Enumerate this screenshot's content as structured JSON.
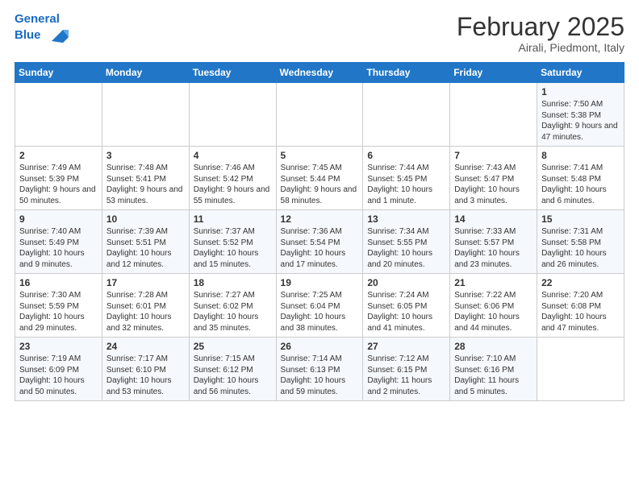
{
  "header": {
    "logo_line1": "General",
    "logo_line2": "Blue",
    "title": "February 2025",
    "subtitle": "Airali, Piedmont, Italy"
  },
  "days_of_week": [
    "Sunday",
    "Monday",
    "Tuesday",
    "Wednesday",
    "Thursday",
    "Friday",
    "Saturday"
  ],
  "weeks": [
    [
      {
        "day": "",
        "info": ""
      },
      {
        "day": "",
        "info": ""
      },
      {
        "day": "",
        "info": ""
      },
      {
        "day": "",
        "info": ""
      },
      {
        "day": "",
        "info": ""
      },
      {
        "day": "",
        "info": ""
      },
      {
        "day": "1",
        "info": "Sunrise: 7:50 AM\nSunset: 5:38 PM\nDaylight: 9 hours and 47 minutes."
      }
    ],
    [
      {
        "day": "2",
        "info": "Sunrise: 7:49 AM\nSunset: 5:39 PM\nDaylight: 9 hours and 50 minutes."
      },
      {
        "day": "3",
        "info": "Sunrise: 7:48 AM\nSunset: 5:41 PM\nDaylight: 9 hours and 53 minutes."
      },
      {
        "day": "4",
        "info": "Sunrise: 7:46 AM\nSunset: 5:42 PM\nDaylight: 9 hours and 55 minutes."
      },
      {
        "day": "5",
        "info": "Sunrise: 7:45 AM\nSunset: 5:44 PM\nDaylight: 9 hours and 58 minutes."
      },
      {
        "day": "6",
        "info": "Sunrise: 7:44 AM\nSunset: 5:45 PM\nDaylight: 10 hours and 1 minute."
      },
      {
        "day": "7",
        "info": "Sunrise: 7:43 AM\nSunset: 5:47 PM\nDaylight: 10 hours and 3 minutes."
      },
      {
        "day": "8",
        "info": "Sunrise: 7:41 AM\nSunset: 5:48 PM\nDaylight: 10 hours and 6 minutes."
      }
    ],
    [
      {
        "day": "9",
        "info": "Sunrise: 7:40 AM\nSunset: 5:49 PM\nDaylight: 10 hours and 9 minutes."
      },
      {
        "day": "10",
        "info": "Sunrise: 7:39 AM\nSunset: 5:51 PM\nDaylight: 10 hours and 12 minutes."
      },
      {
        "day": "11",
        "info": "Sunrise: 7:37 AM\nSunset: 5:52 PM\nDaylight: 10 hours and 15 minutes."
      },
      {
        "day": "12",
        "info": "Sunrise: 7:36 AM\nSunset: 5:54 PM\nDaylight: 10 hours and 17 minutes."
      },
      {
        "day": "13",
        "info": "Sunrise: 7:34 AM\nSunset: 5:55 PM\nDaylight: 10 hours and 20 minutes."
      },
      {
        "day": "14",
        "info": "Sunrise: 7:33 AM\nSunset: 5:57 PM\nDaylight: 10 hours and 23 minutes."
      },
      {
        "day": "15",
        "info": "Sunrise: 7:31 AM\nSunset: 5:58 PM\nDaylight: 10 hours and 26 minutes."
      }
    ],
    [
      {
        "day": "16",
        "info": "Sunrise: 7:30 AM\nSunset: 5:59 PM\nDaylight: 10 hours and 29 minutes."
      },
      {
        "day": "17",
        "info": "Sunrise: 7:28 AM\nSunset: 6:01 PM\nDaylight: 10 hours and 32 minutes."
      },
      {
        "day": "18",
        "info": "Sunrise: 7:27 AM\nSunset: 6:02 PM\nDaylight: 10 hours and 35 minutes."
      },
      {
        "day": "19",
        "info": "Sunrise: 7:25 AM\nSunset: 6:04 PM\nDaylight: 10 hours and 38 minutes."
      },
      {
        "day": "20",
        "info": "Sunrise: 7:24 AM\nSunset: 6:05 PM\nDaylight: 10 hours and 41 minutes."
      },
      {
        "day": "21",
        "info": "Sunrise: 7:22 AM\nSunset: 6:06 PM\nDaylight: 10 hours and 44 minutes."
      },
      {
        "day": "22",
        "info": "Sunrise: 7:20 AM\nSunset: 6:08 PM\nDaylight: 10 hours and 47 minutes."
      }
    ],
    [
      {
        "day": "23",
        "info": "Sunrise: 7:19 AM\nSunset: 6:09 PM\nDaylight: 10 hours and 50 minutes."
      },
      {
        "day": "24",
        "info": "Sunrise: 7:17 AM\nSunset: 6:10 PM\nDaylight: 10 hours and 53 minutes."
      },
      {
        "day": "25",
        "info": "Sunrise: 7:15 AM\nSunset: 6:12 PM\nDaylight: 10 hours and 56 minutes."
      },
      {
        "day": "26",
        "info": "Sunrise: 7:14 AM\nSunset: 6:13 PM\nDaylight: 10 hours and 59 minutes."
      },
      {
        "day": "27",
        "info": "Sunrise: 7:12 AM\nSunset: 6:15 PM\nDaylight: 11 hours and 2 minutes."
      },
      {
        "day": "28",
        "info": "Sunrise: 7:10 AM\nSunset: 6:16 PM\nDaylight: 11 hours and 5 minutes."
      },
      {
        "day": "",
        "info": ""
      }
    ]
  ]
}
